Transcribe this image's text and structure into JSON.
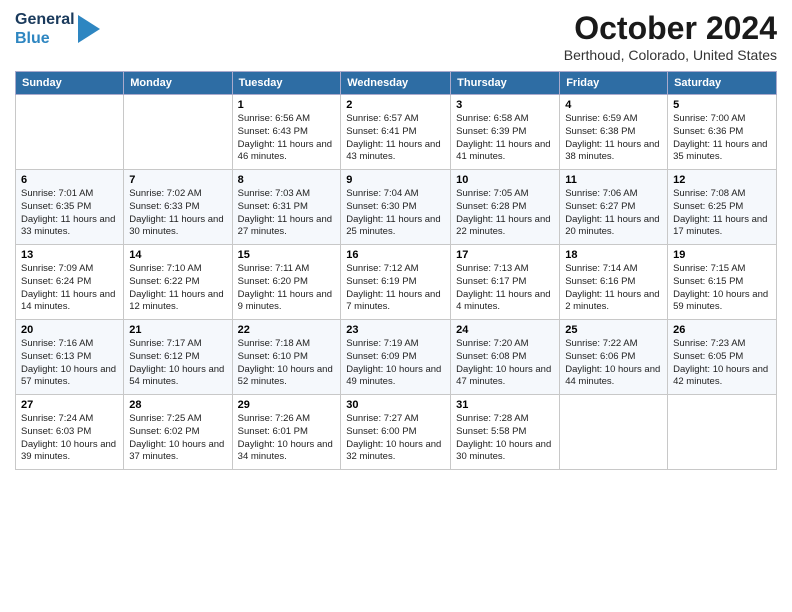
{
  "header": {
    "logo_line1": "General",
    "logo_line2": "Blue",
    "main_title": "October 2024",
    "subtitle": "Berthoud, Colorado, United States"
  },
  "weekdays": [
    "Sunday",
    "Monday",
    "Tuesday",
    "Wednesday",
    "Thursday",
    "Friday",
    "Saturday"
  ],
  "weeks": [
    [
      {
        "day": "",
        "info": ""
      },
      {
        "day": "",
        "info": ""
      },
      {
        "day": "1",
        "info": "Sunrise: 6:56 AM\nSunset: 6:43 PM\nDaylight: 11 hours and 46 minutes."
      },
      {
        "day": "2",
        "info": "Sunrise: 6:57 AM\nSunset: 6:41 PM\nDaylight: 11 hours and 43 minutes."
      },
      {
        "day": "3",
        "info": "Sunrise: 6:58 AM\nSunset: 6:39 PM\nDaylight: 11 hours and 41 minutes."
      },
      {
        "day": "4",
        "info": "Sunrise: 6:59 AM\nSunset: 6:38 PM\nDaylight: 11 hours and 38 minutes."
      },
      {
        "day": "5",
        "info": "Sunrise: 7:00 AM\nSunset: 6:36 PM\nDaylight: 11 hours and 35 minutes."
      }
    ],
    [
      {
        "day": "6",
        "info": "Sunrise: 7:01 AM\nSunset: 6:35 PM\nDaylight: 11 hours and 33 minutes."
      },
      {
        "day": "7",
        "info": "Sunrise: 7:02 AM\nSunset: 6:33 PM\nDaylight: 11 hours and 30 minutes."
      },
      {
        "day": "8",
        "info": "Sunrise: 7:03 AM\nSunset: 6:31 PM\nDaylight: 11 hours and 27 minutes."
      },
      {
        "day": "9",
        "info": "Sunrise: 7:04 AM\nSunset: 6:30 PM\nDaylight: 11 hours and 25 minutes."
      },
      {
        "day": "10",
        "info": "Sunrise: 7:05 AM\nSunset: 6:28 PM\nDaylight: 11 hours and 22 minutes."
      },
      {
        "day": "11",
        "info": "Sunrise: 7:06 AM\nSunset: 6:27 PM\nDaylight: 11 hours and 20 minutes."
      },
      {
        "day": "12",
        "info": "Sunrise: 7:08 AM\nSunset: 6:25 PM\nDaylight: 11 hours and 17 minutes."
      }
    ],
    [
      {
        "day": "13",
        "info": "Sunrise: 7:09 AM\nSunset: 6:24 PM\nDaylight: 11 hours and 14 minutes."
      },
      {
        "day": "14",
        "info": "Sunrise: 7:10 AM\nSunset: 6:22 PM\nDaylight: 11 hours and 12 minutes."
      },
      {
        "day": "15",
        "info": "Sunrise: 7:11 AM\nSunset: 6:20 PM\nDaylight: 11 hours and 9 minutes."
      },
      {
        "day": "16",
        "info": "Sunrise: 7:12 AM\nSunset: 6:19 PM\nDaylight: 11 hours and 7 minutes."
      },
      {
        "day": "17",
        "info": "Sunrise: 7:13 AM\nSunset: 6:17 PM\nDaylight: 11 hours and 4 minutes."
      },
      {
        "day": "18",
        "info": "Sunrise: 7:14 AM\nSunset: 6:16 PM\nDaylight: 11 hours and 2 minutes."
      },
      {
        "day": "19",
        "info": "Sunrise: 7:15 AM\nSunset: 6:15 PM\nDaylight: 10 hours and 59 minutes."
      }
    ],
    [
      {
        "day": "20",
        "info": "Sunrise: 7:16 AM\nSunset: 6:13 PM\nDaylight: 10 hours and 57 minutes."
      },
      {
        "day": "21",
        "info": "Sunrise: 7:17 AM\nSunset: 6:12 PM\nDaylight: 10 hours and 54 minutes."
      },
      {
        "day": "22",
        "info": "Sunrise: 7:18 AM\nSunset: 6:10 PM\nDaylight: 10 hours and 52 minutes."
      },
      {
        "day": "23",
        "info": "Sunrise: 7:19 AM\nSunset: 6:09 PM\nDaylight: 10 hours and 49 minutes."
      },
      {
        "day": "24",
        "info": "Sunrise: 7:20 AM\nSunset: 6:08 PM\nDaylight: 10 hours and 47 minutes."
      },
      {
        "day": "25",
        "info": "Sunrise: 7:22 AM\nSunset: 6:06 PM\nDaylight: 10 hours and 44 minutes."
      },
      {
        "day": "26",
        "info": "Sunrise: 7:23 AM\nSunset: 6:05 PM\nDaylight: 10 hours and 42 minutes."
      }
    ],
    [
      {
        "day": "27",
        "info": "Sunrise: 7:24 AM\nSunset: 6:03 PM\nDaylight: 10 hours and 39 minutes."
      },
      {
        "day": "28",
        "info": "Sunrise: 7:25 AM\nSunset: 6:02 PM\nDaylight: 10 hours and 37 minutes."
      },
      {
        "day": "29",
        "info": "Sunrise: 7:26 AM\nSunset: 6:01 PM\nDaylight: 10 hours and 34 minutes."
      },
      {
        "day": "30",
        "info": "Sunrise: 7:27 AM\nSunset: 6:00 PM\nDaylight: 10 hours and 32 minutes."
      },
      {
        "day": "31",
        "info": "Sunrise: 7:28 AM\nSunset: 5:58 PM\nDaylight: 10 hours and 30 minutes."
      },
      {
        "day": "",
        "info": ""
      },
      {
        "day": "",
        "info": ""
      }
    ]
  ]
}
